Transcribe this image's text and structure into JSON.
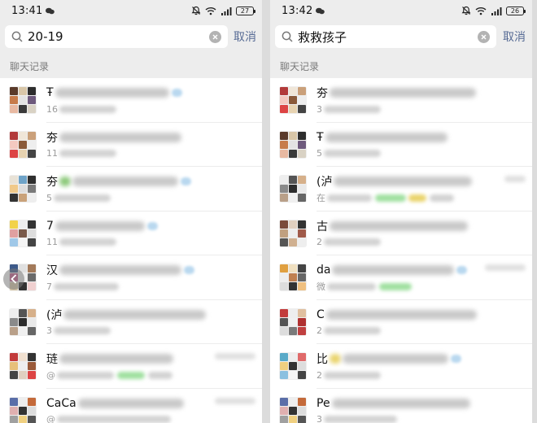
{
  "colors": {
    "accent": "#576b95",
    "link_green": "#07c160",
    "bg": "#ededed",
    "cloud": "#b9d8ef"
  },
  "left": {
    "status_time": "13:41",
    "battery": "27",
    "search_query": "20-19",
    "cancel_label": "取消",
    "section_title": "聊天记录",
    "results": [
      {
        "lead": "Ŧ",
        "sub_lead": "16"
      },
      {
        "lead": "夯",
        "sub_lead": "11"
      },
      {
        "lead": "夯",
        "sub_lead": "5"
      },
      {
        "lead": "7",
        "sub_lead": "11"
      },
      {
        "lead": "汉",
        "sub_lead": "7"
      },
      {
        "lead": "(泸",
        "sub_lead": "3"
      },
      {
        "lead": "琏",
        "sub_lead": "@"
      },
      {
        "lead": "CaCa",
        "sub_lead": "@"
      }
    ]
  },
  "right": {
    "status_time": "13:42",
    "battery": "26",
    "search_query": "救救孩子",
    "cancel_label": "取消",
    "section_title": "聊天记录",
    "results": [
      {
        "lead": "夯",
        "sub_lead": "3"
      },
      {
        "lead": "Ŧ",
        "sub_lead": "5"
      },
      {
        "lead": "(泸",
        "sub_lead": "在"
      },
      {
        "lead": "古",
        "sub_lead": "2"
      },
      {
        "lead": "da",
        "sub_lead": "微"
      },
      {
        "lead": "C",
        "sub_lead": "2"
      },
      {
        "lead": "比",
        "sub_lead": "2"
      },
      {
        "lead": "Pe",
        "sub_lead": "3"
      }
    ]
  }
}
